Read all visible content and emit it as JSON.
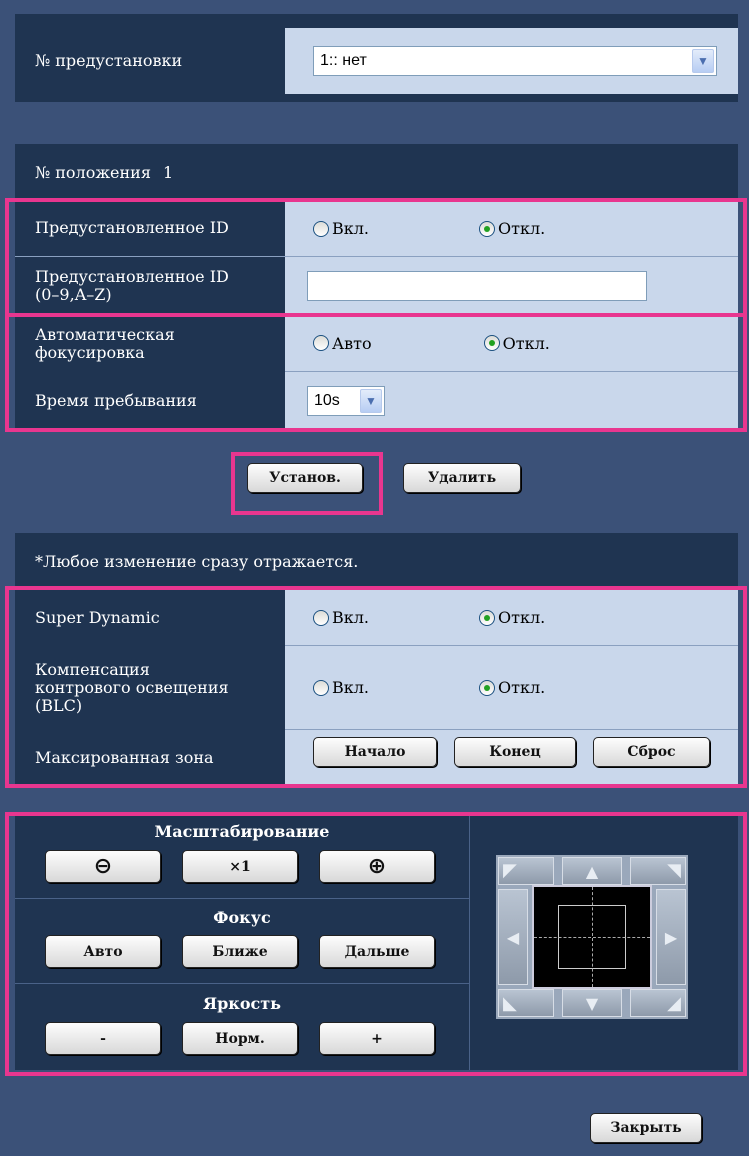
{
  "preset": {
    "label": "№ предустановки",
    "value": "1:: нет"
  },
  "position": {
    "label": "№ положения",
    "number": "1"
  },
  "preset_id": {
    "label": "Предустановленное ID",
    "on": "Вкл.",
    "off": "Откл."
  },
  "preset_id_text": {
    "label_line1": "Предустановленное ID",
    "label_line2": "(0–9,A–Z)",
    "value": ""
  },
  "autofocus": {
    "label_line1": "Автоматическая",
    "label_line2": "фокусировка",
    "auto": "Авто",
    "off": "Откл."
  },
  "dwell": {
    "label": "Время пребывания",
    "value": "10s"
  },
  "buttons": {
    "set": "Установ.",
    "delete": "Удалить",
    "close": "Закрыть"
  },
  "notice": "*Любое изменение сразу отражается.",
  "super_dynamic": {
    "label": "Super Dynamic",
    "on": "Вкл.",
    "off": "Откл."
  },
  "blc": {
    "label_line1": "Компенсация",
    "label_line2": "контрового освещения",
    "label_line3": "(BLC)",
    "on": "Вкл.",
    "off": "Откл."
  },
  "mask": {
    "label": "Максированная зона",
    "start": "Начало",
    "end": "Конец",
    "reset": "Сброс"
  },
  "control": {
    "zoom": {
      "title": "Масштабирование",
      "x1": "×1"
    },
    "focus": {
      "title": "Фокус",
      "auto": "Авто",
      "near": "Ближе",
      "far": "Дальше"
    },
    "brightness": {
      "title": "Яркость",
      "minus": "-",
      "normal": "Норм.",
      "plus": "+"
    }
  },
  "colors": {
    "background": "#3b5178",
    "panel": "#1f3451",
    "value_cell": "#c9d7eb",
    "highlight": "#e8368f"
  }
}
